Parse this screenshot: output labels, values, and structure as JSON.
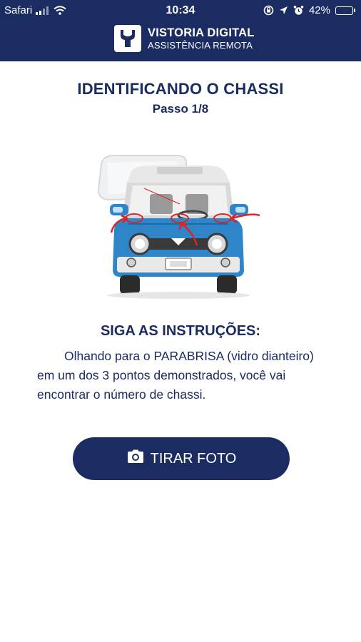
{
  "status_bar": {
    "carrier": "Safari",
    "time": "10:34",
    "battery_percent": "42%",
    "battery_level": 0.42,
    "icons": [
      "signal-bars-icon",
      "wifi-icon",
      "screen-rotation-lock-icon",
      "location-arrow-icon",
      "alarm-clock-icon",
      "battery-icon"
    ]
  },
  "brand": {
    "title": "VISTORIA DIGITAL",
    "subtitle": "ASSISTÊNCIA REMOTA",
    "logo_icon": "wrench-icon"
  },
  "screen": {
    "title": "IDENTIFICANDO O CHASSI",
    "step": "Passo 1/8"
  },
  "illustration": {
    "icon": "car-windshield-chassis-illustration",
    "car_color": "#2e86c9",
    "arrow_color": "#d9262a"
  },
  "instructions": {
    "title": "SIGA AS INSTRUÇÕES:",
    "text": "Olhando para o PARABRISA (vidro dianteiro) em um dos 3 pontos demonstrados, você vai encontrar o número de chassi."
  },
  "action": {
    "label": "TIRAR FOTO",
    "icon": "camera-icon"
  },
  "colors": {
    "primary": "#1b2c63",
    "background": "#ffffff"
  }
}
